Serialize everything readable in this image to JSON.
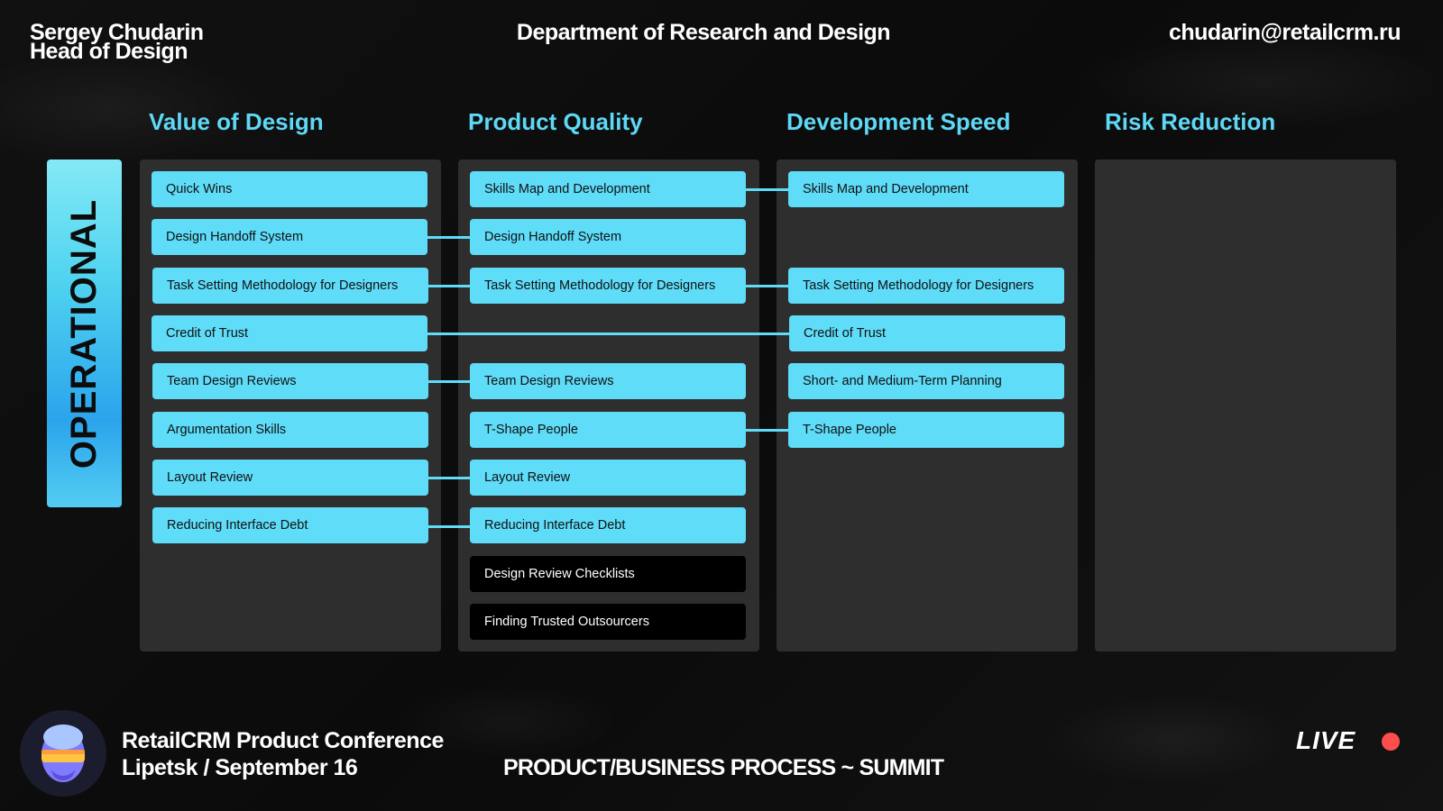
{
  "header": {
    "speaker_name": "Sergey Chudarin",
    "speaker_role": "Head of Design",
    "department": "Department of Research and Design",
    "email": "chudarin@retailcrm.ru"
  },
  "columns": [
    {
      "title": "Value of Design"
    },
    {
      "title": "Product Quality"
    },
    {
      "title": "Development Speed"
    },
    {
      "title": "Risk Reduction"
    }
  ],
  "row_label": "OPERATIONAL",
  "value_cards": [
    "Quick Wins",
    "Design Handoff System",
    "Task Setting Methodology for Designers",
    "Credit of Trust",
    "Team Design Reviews",
    "Argumentation Skills",
    "Layout Review",
    "Reducing Interface Debt"
  ],
  "quality_cards": [
    "Skills Map and Development",
    "Design Handoff System",
    "Task Setting Methodology for Designers",
    "Team Design Reviews",
    "T-Shape People",
    "Layout Review",
    "Reducing Interface Debt",
    "Design Review Checklists",
    "Finding Trusted Outsourcers"
  ],
  "speed_cards": [
    "Skills Map and Development",
    "Task Setting Methodology for Designers",
    "Credit of Trust",
    "Short- and Medium-Term Planning",
    "T-Shape People"
  ],
  "footer": {
    "conference": "RetailCRM Product Conference",
    "place_date": "Lipetsk / September 16",
    "event": "PRODUCT/BUSINESS PROCESS ~ SUMMIT",
    "live": "LIVE"
  },
  "colors": {
    "accent": "#5fdcf8",
    "panel": "#2e2e2e",
    "background": "#0d0d0d",
    "live_dot": "#ff4d4d"
  }
}
